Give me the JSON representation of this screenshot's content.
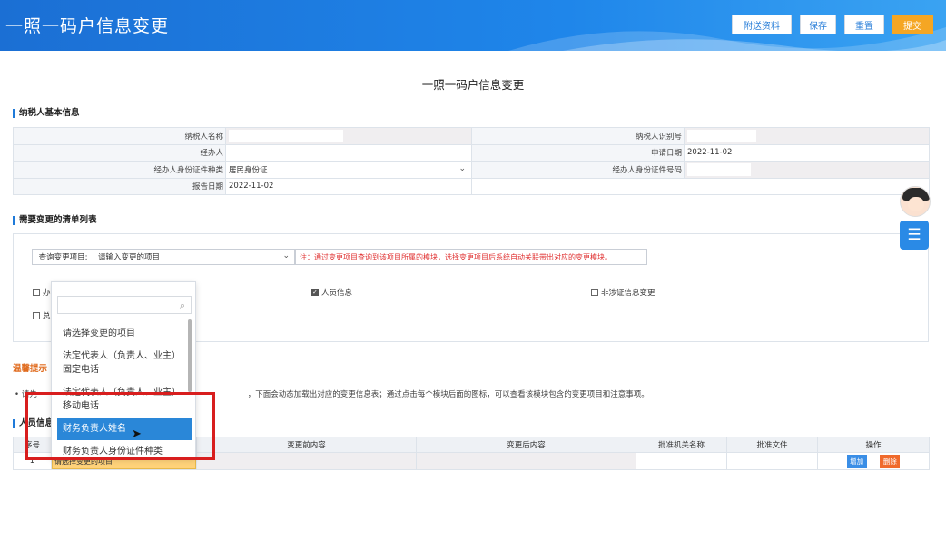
{
  "header": {
    "title": "一照一码户信息变更",
    "buttons": {
      "attach": "附送资料",
      "save": "保存",
      "reset": "重置",
      "submit": "提交"
    }
  },
  "page_title": "一照一码户信息变更",
  "sections": {
    "basic_info": "纳税人基本信息",
    "change_list": "需要变更的清单列表",
    "tips": "温馨提示",
    "people": "人员信息"
  },
  "basic_info": {
    "taxpayer_name_label": "纳税人名称",
    "taxpayer_id_label": "纳税人识别号",
    "agent_label": "经办人",
    "apply_date_label": "申请日期",
    "apply_date": "2022-11-02",
    "id_type_label": "经办人身份证件种类",
    "id_type": "居民身份证",
    "id_number_label": "经办人身份证件号码",
    "report_date_label": "报告日期",
    "report_date": "2022-11-02"
  },
  "change_list": {
    "query_label": "查询变更项目:",
    "query_placeholder": "请输入变更的项目",
    "note": "注：通过变更项目查询到该项目所属的模块，选择变更项目后系统自动关联带出对应的变更模块。",
    "checkboxes": [
      {
        "label": "办",
        "checked": false
      },
      {
        "label": "人员信息",
        "checked": true
      },
      {
        "label": "非涉证信息变更",
        "checked": false
      },
      {
        "label": "总",
        "checked": false
      }
    ]
  },
  "tips": {
    "text_left": "请先",
    "text_right": "，下面会动态加载出对应的变更信息表；通过点击每个模块后面的图标，可以查看该模块包含的变更项目和注意事项。"
  },
  "people_table": {
    "headers": [
      "序号",
      "",
      "变更前内容",
      "变更后内容",
      "批准机关名称",
      "批准文件",
      "操作"
    ],
    "row": {
      "index": "1",
      "select_value": "请选择变更的项目"
    },
    "add_label": "增加",
    "delete_label": "删除"
  },
  "dropdown": {
    "items": [
      "请选择变更的项目",
      "法定代表人（负责人、业主）",
      "固定电话",
      "法定代表人（负责人、业主）",
      "移动电话",
      "财务负责人姓名",
      "财务负责人身份证件种类"
    ],
    "active_index": 5
  },
  "colors": {
    "header": "#1f86ea",
    "accent": "#f5a623",
    "highlight": "#d81e1e",
    "note": "#e03131"
  }
}
